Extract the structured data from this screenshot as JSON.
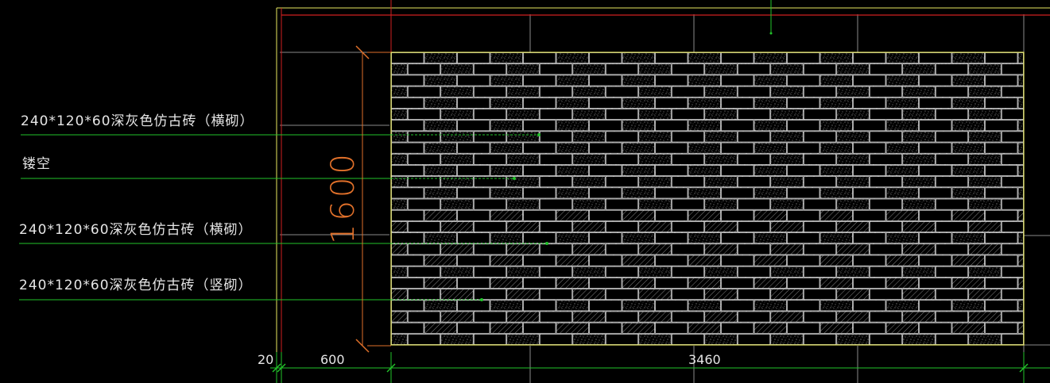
{
  "annotations": [
    {
      "text": "240*120*60深灰色仿古砖（横砌）"
    },
    {
      "text": "镂空"
    },
    {
      "text": "240*120*60深灰色仿古砖（横砌）"
    },
    {
      "text": "240*120*60深灰色仿古砖（竖砌）"
    }
  ],
  "dimensions": {
    "height": "1600",
    "offset_small": "20",
    "offset_left": "600",
    "width": "3460"
  },
  "colors": {
    "background": "#000000",
    "outline_yellow": "#e8e860",
    "leader_green": "#22c42a",
    "grid_gray": "#8a8a8a",
    "frame_red": "#d02020",
    "dimension_orange": "#e0702a",
    "brick_white": "#f0f0f0",
    "text_white": "#e6e6e6"
  }
}
